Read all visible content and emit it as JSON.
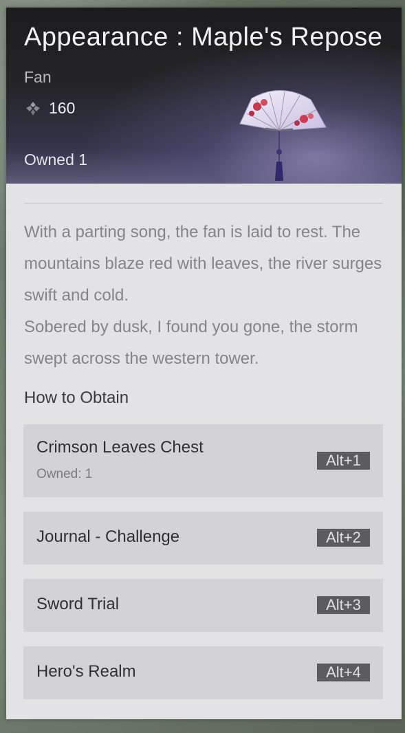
{
  "item": {
    "title": "Appearance : Maple's Repose",
    "type": "Fan",
    "price": "160",
    "owned": "Owned 1",
    "currency_icon": "jade-currency-icon",
    "preview_icon": "folding-fan-icon"
  },
  "description": [
    "With a parting song, the fan is laid to rest. The mountains blaze red with leaves, the river surges swift and cold.",
    "Sobered by dusk, I found you gone, the storm swept across the western tower."
  ],
  "obtain": {
    "label": "How to Obtain",
    "sources": [
      {
        "name": "Crimson Leaves Chest",
        "sub": "Owned: 1",
        "hotkey": "Alt+1"
      },
      {
        "name": "Journal - Challenge",
        "hotkey": "Alt+2"
      },
      {
        "name": "Sword Trial",
        "hotkey": "Alt+3"
      },
      {
        "name": "Hero's Realm",
        "hotkey": "Alt+4"
      }
    ]
  },
  "colors": {
    "header_dark": "#1c1c1e",
    "panel_bg": "#e3e3e6",
    "row_bg": "#d3d3d7",
    "hotkey_bg": "#5b5b60"
  }
}
